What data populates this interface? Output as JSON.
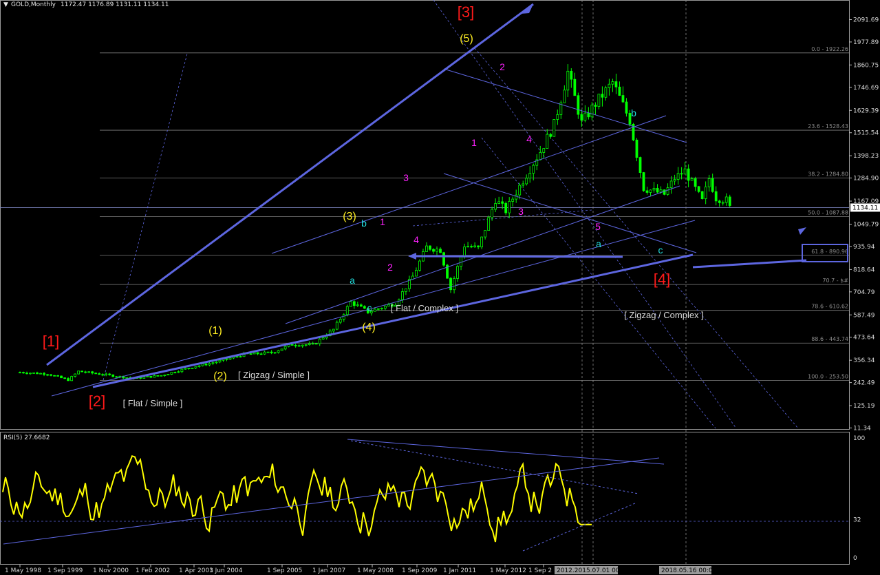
{
  "header": {
    "symbol": "GOLD,Monthly",
    "ohlc": "1172.47 1176.89 1131.11 1134.11"
  },
  "rsi_header": "RSI(5) 27.6682",
  "colors": {
    "background": "#000000",
    "candle": "#00ff00",
    "trend_lines": "#5d66e0",
    "fib_lines": "#7e7e7e",
    "rsi_line": "#ffff00",
    "wave_primary": "#ff1a1a",
    "wave_intermediate": "#ffee22",
    "wave_minor": "#ff22ff",
    "wave_abc": "#22dddd",
    "note": "#dddddd"
  },
  "chart_data": [
    {
      "type": "candlestick",
      "title": "GOLD,Monthly",
      "y_axis": {
        "scale": "log",
        "range": [
          11.34,
          2200
        ]
      },
      "y_ticks": [
        "2091.69",
        "1977.89",
        "1860.75",
        "1746.69",
        "1629.39",
        "1515.54",
        "1398.23",
        "1284.90",
        "1167.09",
        "1049.79",
        "935.94",
        "818.64",
        "704.79",
        "587.49",
        "473.64",
        "356.34",
        "242.49",
        "125.19",
        "11.34"
      ],
      "x_ticks": [
        "1 May 1998",
        "1 Sep 1999",
        "1 Nov 2000",
        "1 Feb 2002",
        "1 Apr 2003",
        "1 Jun 2004",
        "1 Sep 2005",
        "1 Jan 2007",
        "1 May 2008",
        "1 Sep 2009",
        "1 Jan 2011",
        "1 May 2012",
        "1 Sep 2"
      ],
      "time_markers": [
        "2012.2015.07.01 00:00",
        "2018.05.16 00:00"
      ],
      "last_price": "1134.11",
      "price_series": [
        {
          "date": "1998-05",
          "close": 295
        },
        {
          "date": "1999-01",
          "close": 287
        },
        {
          "date": "1999-07",
          "close": 256
        },
        {
          "date": "1999-10",
          "close": 300
        },
        {
          "date": "2000-06",
          "close": 282
        },
        {
          "date": "2001-02",
          "close": 264
        },
        {
          "date": "2001-10",
          "close": 279
        },
        {
          "date": "2002-06",
          "close": 318
        },
        {
          "date": "2003-02",
          "close": 348
        },
        {
          "date": "2003-10",
          "close": 386
        },
        {
          "date": "2004-06",
          "close": 395
        },
        {
          "date": "2004-12",
          "close": 437
        },
        {
          "date": "2005-06",
          "close": 435
        },
        {
          "date": "2005-12",
          "close": 513
        },
        {
          "date": "2006-05",
          "close": 653
        },
        {
          "date": "2006-10",
          "close": 603
        },
        {
          "date": "2007-06",
          "close": 648
        },
        {
          "date": "2007-11",
          "close": 783
        },
        {
          "date": "2008-03",
          "close": 933
        },
        {
          "date": "2008-07",
          "close": 918
        },
        {
          "date": "2008-10",
          "close": 718
        },
        {
          "date": "2009-02",
          "close": 942
        },
        {
          "date": "2009-06",
          "close": 926
        },
        {
          "date": "2009-11",
          "close": 1175
        },
        {
          "date": "2010-02",
          "close": 1118
        },
        {
          "date": "2010-06",
          "close": 1244
        },
        {
          "date": "2010-12",
          "close": 1420
        },
        {
          "date": "2011-04",
          "close": 1556
        },
        {
          "date": "2011-08",
          "close": 1825
        },
        {
          "date": "2011-12",
          "close": 1565
        },
        {
          "date": "2012-04",
          "close": 1664
        },
        {
          "date": "2012-09",
          "close": 1772
        },
        {
          "date": "2013-02",
          "close": 1578
        },
        {
          "date": "2013-06",
          "close": 1234
        },
        {
          "date": "2013-12",
          "close": 1202
        },
        {
          "date": "2014-03",
          "close": 1284
        },
        {
          "date": "2014-06",
          "close": 1322
        },
        {
          "date": "2014-11",
          "close": 1167
        },
        {
          "date": "2015-01",
          "close": 1283
        },
        {
          "date": "2015-03",
          "close": 1183
        },
        {
          "date": "2015-06",
          "close": 1172
        },
        {
          "date": "2015-07",
          "close": 1134
        }
      ],
      "fib_levels": [
        {
          "pct": "0.0",
          "value": 1922.26,
          "label": "0.0 - 1922.26"
        },
        {
          "pct": "23.6",
          "value": 1528.43,
          "label": "23.6 - 1528.43"
        },
        {
          "pct": "38.2",
          "value": 1284.8,
          "label": "38.2 - 1284.80"
        },
        {
          "pct": "50.0",
          "value": 1087.88,
          "label": "50.0 - 1087.88"
        },
        {
          "pct": "61.8",
          "value": 890.96,
          "label": "61.8 - 890.96"
        },
        {
          "pct": "70.7",
          "value": 742.44,
          "label": "70.7 - $#"
        },
        {
          "pct": "78.6",
          "value": 610.62,
          "label": "78.6 - 610.62"
        },
        {
          "pct": "88.6",
          "value": 443.74,
          "label": "88.6 - 443.74"
        },
        {
          "pct": "100.0",
          "value": 253.5,
          "label": "100.0 - 253.50"
        }
      ],
      "wave_labels": {
        "primary": [
          "[1]",
          "[2]",
          "[3]",
          "[4]"
        ],
        "intermediate": [
          "(1)",
          "(2)",
          "(3)",
          "(4)",
          "(5)"
        ],
        "minor": [
          "1",
          "2",
          "3",
          "4",
          "1",
          "2",
          "3",
          "4",
          "5"
        ],
        "abc": [
          "a",
          "b",
          "c",
          "a",
          "b",
          "c"
        ],
        "notes": [
          "[ Flat / Simple ]",
          "[ Zigzag / Simple ]",
          "[ Flat / Complex ]",
          "[ Zigzag / Complex ]"
        ]
      }
    },
    {
      "type": "line",
      "title": "RSI(5) 27.6682",
      "y_axis": {
        "range": [
          0,
          100
        ]
      },
      "y_ticks": [
        "100",
        "32",
        "0"
      ],
      "series": [
        {
          "name": "RSI(5)",
          "value": 27.6682
        }
      ]
    }
  ]
}
